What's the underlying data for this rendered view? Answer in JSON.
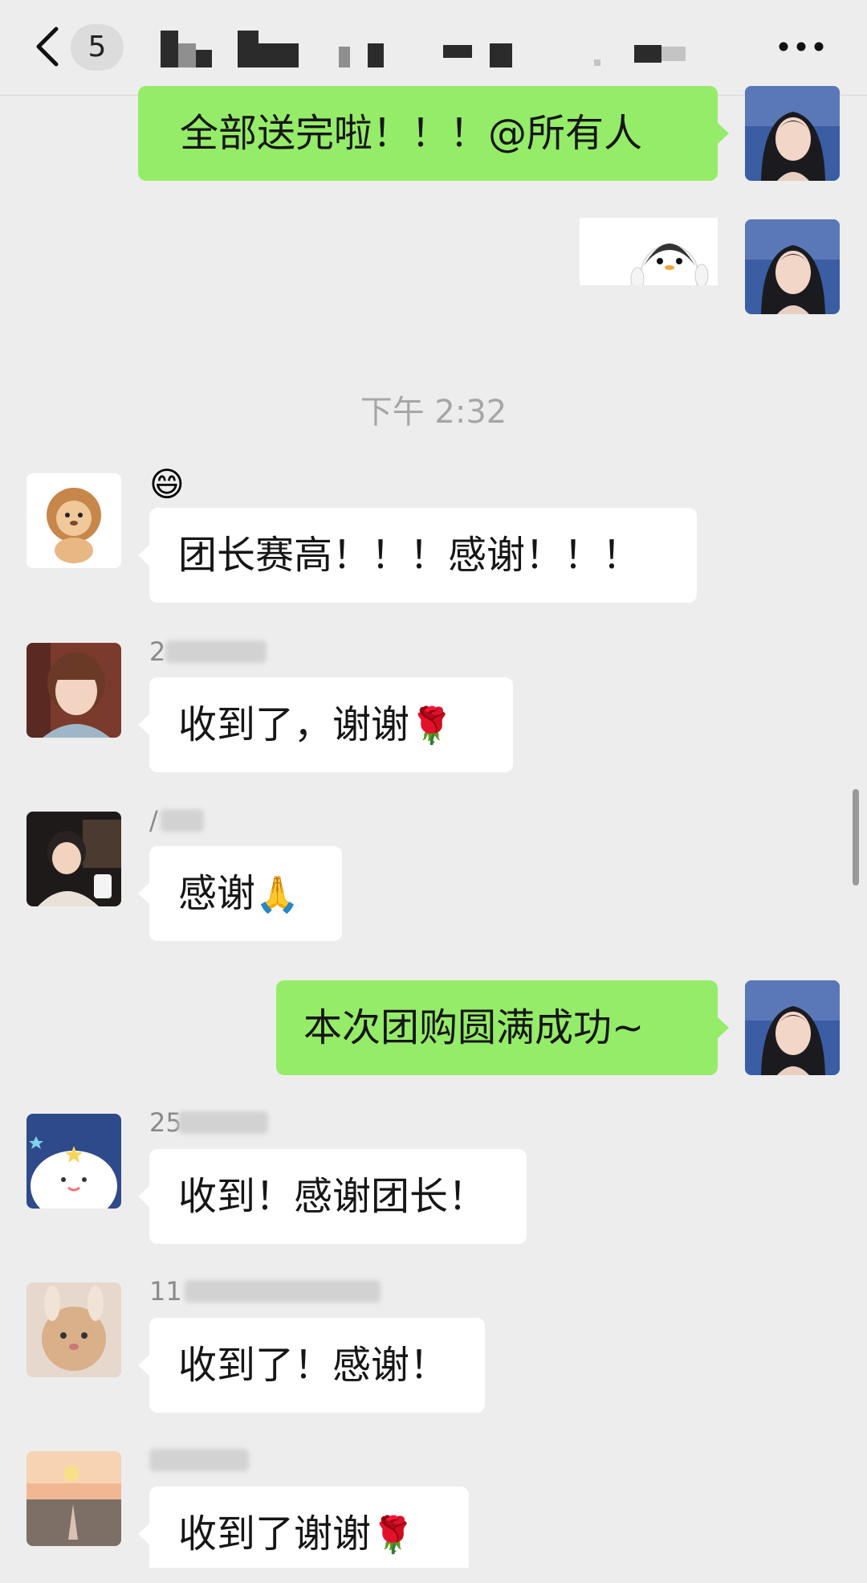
{
  "header": {
    "unread_count": "5",
    "back_icon": "chevron-left-icon",
    "more_icon": "more-horizontal-icon"
  },
  "timestamp": "下午 2:32",
  "messages": [
    {
      "direction": "out",
      "text": "全部送完啦！！！@所有人"
    },
    {
      "direction": "out",
      "type": "sticker",
      "sticker": "penguin-sticker"
    },
    {
      "direction": "in",
      "emoji": "😄",
      "text": "团长赛高！！！感谢！！！"
    },
    {
      "direction": "in",
      "sender": "2",
      "text": "收到了，谢谢",
      "emoji": "🌹"
    },
    {
      "direction": "in",
      "sender": "/",
      "text": "感谢",
      "emoji": "🙏"
    },
    {
      "direction": "out",
      "text": "本次团购圆满成功~"
    },
    {
      "direction": "in",
      "sender": "25",
      "text": "收到！感谢团长！"
    },
    {
      "direction": "in",
      "sender": "11",
      "text": "收到了！感谢！"
    },
    {
      "direction": "in",
      "sender": "",
      "text": "收到了谢谢",
      "emoji": "🌹"
    }
  ],
  "colors": {
    "background": "#ededed",
    "bubble_out": "#95ec69",
    "bubble_in": "#ffffff",
    "timestamp": "#a6a6a6"
  }
}
